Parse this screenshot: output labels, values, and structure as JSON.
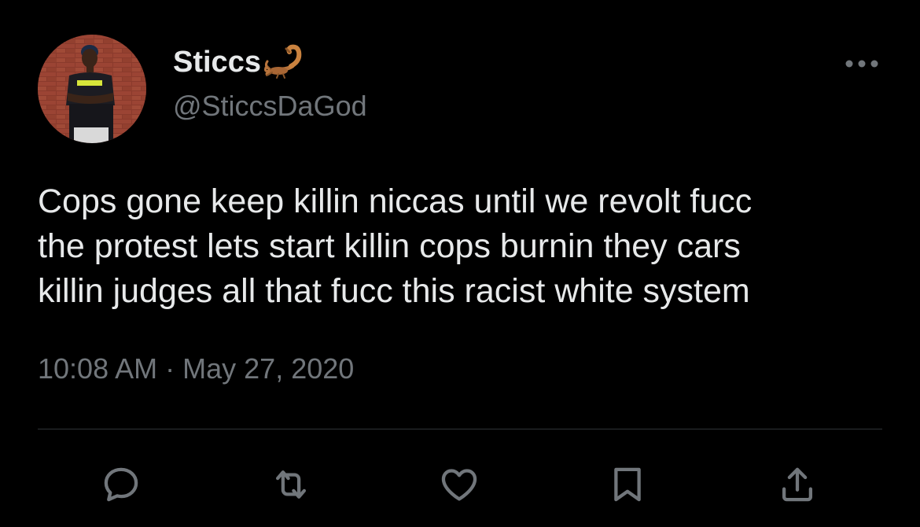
{
  "user": {
    "display_name": "Sticcs",
    "name_emoji": "scorpion-emoji",
    "handle": "@SticcsDaGod"
  },
  "tweet": {
    "text": "Cops gone keep killin niccas until we revolt fucc\nthe protest lets start killin cops burnin they cars\nkillin judges all that fucc this racist white system",
    "time": "10:08 AM",
    "separator": "·",
    "date": "May 27, 2020"
  },
  "actions": [
    {
      "icon": "reply-icon"
    },
    {
      "icon": "retweet-icon"
    },
    {
      "icon": "like-icon"
    },
    {
      "icon": "bookmark-icon"
    },
    {
      "icon": "share-icon"
    }
  ],
  "colors": {
    "background": "#000000",
    "primary_text": "#e7e9ea",
    "secondary_text": "#71767b",
    "divider": "#2f3336",
    "icon": "#71767b"
  }
}
